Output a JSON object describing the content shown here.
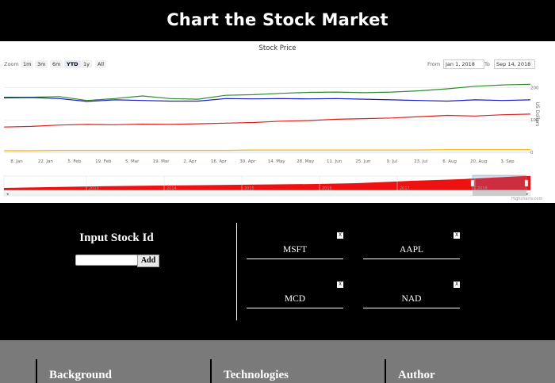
{
  "header": {
    "title": "Chart the Stock Market"
  },
  "chart_data": {
    "type": "line",
    "title": "Stock Price",
    "ylabel": "US Dollars",
    "y_ticks": [
      "0",
      "100",
      "200"
    ],
    "ylim": [
      0,
      250
    ],
    "x_ticks": [
      "8. Jan",
      "22. Jan",
      "5. Feb",
      "19. Feb",
      "5. Mar",
      "19. Mar",
      "2. Apr",
      "16. Apr",
      "30. Apr",
      "14. May",
      "28. May",
      "11. Jun",
      "25. Jun",
      "9. Jul",
      "23. Jul",
      "6. Aug",
      "20. Aug",
      "3. Sep"
    ],
    "x": [
      "1. Jan",
      "15. Jan",
      "29. Jan",
      "12. Feb",
      "26. Feb",
      "12. Mar",
      "26. Mar",
      "9. Apr",
      "23. Apr",
      "7. May",
      "21. May",
      "4. Jun",
      "18. Jun",
      "2. Jul",
      "16. Jul",
      "30. Jul",
      "13. Aug",
      "27. Aug",
      "10. Sep",
      "14. Sep"
    ],
    "series": [
      {
        "color": "#2e8b2e",
        "values": [
          170,
          170,
          172,
          160,
          166,
          174,
          166,
          164,
          176,
          178,
          182,
          185,
          186,
          184,
          186,
          190,
          196,
          204,
          208,
          210
        ]
      },
      {
        "color": "#1a1ac8",
        "values": [
          168,
          169,
          166,
          157,
          162,
          160,
          158,
          158,
          166,
          165,
          166,
          165,
          166,
          164,
          162,
          160,
          158,
          162,
          160,
          162
        ]
      },
      {
        "color": "#e02020",
        "values": [
          78,
          80,
          84,
          86,
          85,
          87,
          86,
          88,
          90,
          92,
          96,
          98,
          102,
          104,
          106,
          110,
          114,
          112,
          116,
          118
        ]
      },
      {
        "color": "#f0b400",
        "values": [
          5,
          5,
          6,
          6,
          6,
          6,
          6,
          6,
          6,
          7,
          7,
          7,
          7,
          7,
          7,
          7,
          8,
          8,
          8,
          8
        ]
      }
    ],
    "navigator_years": [
      "2013",
      "2014",
      "2015",
      "2016",
      "2017",
      "2018"
    ],
    "grid": true,
    "legend": "none"
  },
  "chart_ui": {
    "zoom_label": "Zoom",
    "zoom_buttons": [
      "1m",
      "3m",
      "6m",
      "YTD",
      "1y",
      "All"
    ],
    "zoom_active": "YTD",
    "from_label": "From",
    "to_label": "To",
    "from_date": "Jan 1, 2018",
    "to_date": "Sep 14, 2018",
    "credits": "Highcharts.com"
  },
  "input": {
    "title": "Input Stock Id",
    "value": "",
    "button": "Add"
  },
  "stocks": [
    {
      "symbol": "MSFT",
      "close": "X"
    },
    {
      "symbol": "AAPL",
      "close": "X"
    },
    {
      "symbol": "MCD",
      "close": "X"
    },
    {
      "symbol": "NAD",
      "close": "X"
    }
  ],
  "footer": {
    "columns": [
      "Background",
      "Technologies",
      "Author"
    ]
  }
}
